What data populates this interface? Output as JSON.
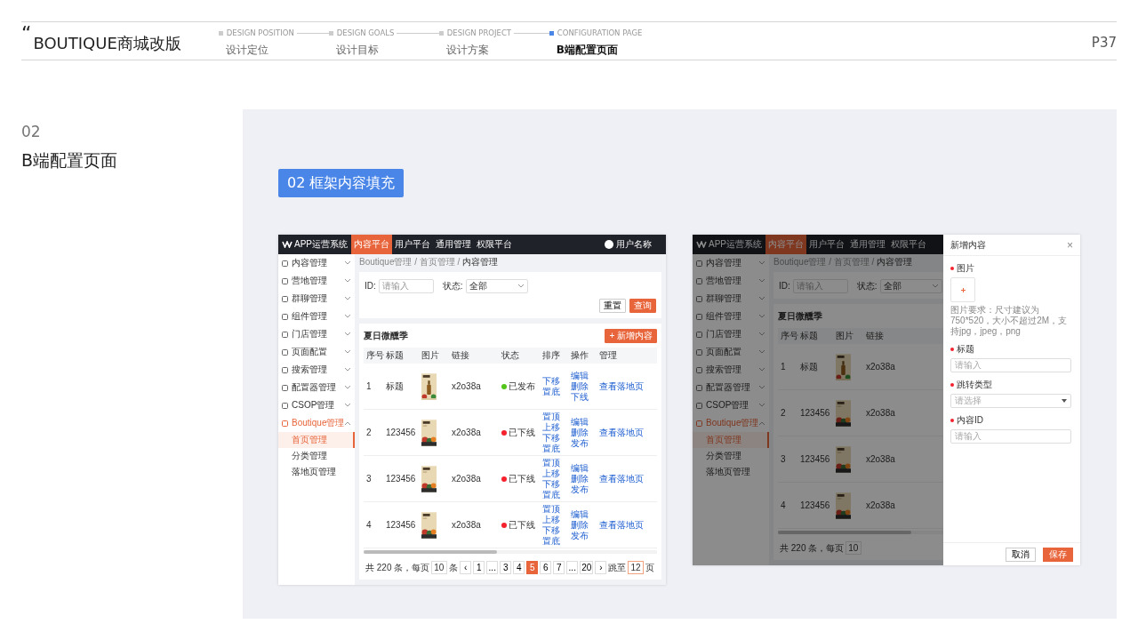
{
  "header": {
    "quote": "“",
    "title": "BOUTIQUE商城改版",
    "page": "P37",
    "steps": [
      {
        "en": "DESIGN POSITION",
        "zh": "设计定位",
        "selected": false
      },
      {
        "en": "DESIGN GOALS",
        "zh": "设计目标",
        "selected": false
      },
      {
        "en": "DESIGN PROJECT",
        "zh": "设计方案",
        "selected": false
      },
      {
        "en": "CONFIGURATION PAGE",
        "zh": "B端配置页面",
        "selected": true
      }
    ]
  },
  "section": {
    "number": "02",
    "title": "B端配置页面"
  },
  "stage_label": "02 框架内容填充",
  "mockups": [
    {
      "app_name": "APP运营系统",
      "user": "用户名称",
      "top_tabs": [
        {
          "label": "内容平台",
          "selected": true
        },
        {
          "label": "用户平台",
          "selected": false
        },
        {
          "label": "通用管理",
          "selected": false
        },
        {
          "label": "权限平台",
          "selected": false
        }
      ],
      "menu": [
        {
          "label": "内容管理",
          "expanded": false
        },
        {
          "label": "营地管理",
          "expanded": false
        },
        {
          "label": "群聊管理",
          "expanded": false
        },
        {
          "label": "组件管理",
          "expanded": false
        },
        {
          "label": "门店管理",
          "expanded": false
        },
        {
          "label": "页面配置",
          "expanded": false
        },
        {
          "label": "搜索管理",
          "expanded": false
        },
        {
          "label": "配置器管理",
          "expanded": false
        },
        {
          "label": "CSOP管理",
          "expanded": false
        },
        {
          "label": "Boutique管理",
          "expanded": true,
          "children": [
            {
              "label": "首页管理",
              "selected": true
            },
            {
              "label": "分类管理",
              "selected": false
            },
            {
              "label": "落地页管理",
              "selected": false
            }
          ]
        }
      ],
      "breadcrumb": "Boutique管理 / 首页管理 / **内容管理**",
      "filters": [
        {
          "kind": "input",
          "label": "ID:",
          "placeholder": "请输入"
        },
        {
          "kind": "select",
          "label": "状态:",
          "value": "全部"
        }
      ],
      "filter_buttons": [
        {
          "kind": "default",
          "label": "重置"
        },
        {
          "kind": "primary",
          "label": "查询"
        }
      ],
      "table_title": "夏日微醺季",
      "add_button": "+ 新增内容",
      "columns": [
        "序号",
        "标题",
        "图片",
        "链接",
        "状态",
        "排序",
        "操作",
        "管理"
      ],
      "rows": [
        {
          "index": "1",
          "title": "标题",
          "image": {
            "kind": "picture"
          },
          "link": "x2o38a",
          "status": {
            "label": "已发布",
            "color": "#52c41a"
          },
          "sort": [
            "下移",
            "置底"
          ],
          "actions": [
            "编辑",
            "删除",
            "下线"
          ],
          "manage": "查看落地页"
        },
        {
          "index": "2",
          "title": "123456",
          "image": {
            "kind": "picture"
          },
          "link": "x2o38a",
          "status": {
            "label": "已下线",
            "color": "#f5222d"
          },
          "sort": [
            "置顶",
            "上移",
            "下移",
            "置底"
          ],
          "actions": [
            "编辑",
            "删除",
            "发布"
          ],
          "manage": "查看落地页"
        },
        {
          "index": "3",
          "title": "123456",
          "image": {
            "kind": "picture"
          },
          "link": "x2o38a",
          "status": {
            "label": "已下线",
            "color": "#f5222d"
          },
          "sort": [
            "置顶",
            "上移",
            "下移",
            "置底"
          ],
          "actions": [
            "编辑",
            "删除",
            "发布"
          ],
          "manage": "查看落地页"
        },
        {
          "index": "4",
          "title": "123456",
          "image": {
            "kind": "picture"
          },
          "link": "x2o38a",
          "status": {
            "label": "已下线",
            "color": "#f5222d"
          },
          "sort": [
            "置顶",
            "上移",
            "下移",
            "置底"
          ],
          "actions": [
            "编辑",
            "删除",
            "发布"
          ],
          "manage": "查看落地页"
        }
      ],
      "pagination": {
        "total": "共 220 条，每页",
        "page_size": "10",
        "unit": "条",
        "pages": [
          {
            "label": "‹",
            "selected": false
          },
          {
            "label": "1",
            "selected": false
          },
          {
            "label": "...",
            "selected": false
          },
          {
            "label": "3",
            "selected": false
          },
          {
            "label": "4",
            "selected": false
          },
          {
            "label": "5",
            "selected": true
          },
          {
            "label": "6",
            "selected": false
          },
          {
            "label": "7",
            "selected": false
          },
          {
            "label": "...",
            "selected": false
          },
          {
            "label": "20",
            "selected": false
          },
          {
            "label": "›",
            "selected": false
          }
        ],
        "jump_label": "跳至",
        "jump_value": "12",
        "jump_unit": "页"
      }
    },
    {
      "app_name": "APP运营系统",
      "top_tabs": [
        {
          "label": "内容平台",
          "selected": true
        },
        {
          "label": "用户平台",
          "selected": false
        },
        {
          "label": "通用管理",
          "selected": false
        },
        {
          "label": "权限平台",
          "selected": false
        }
      ],
      "menu": [
        {
          "label": "内容管理",
          "expanded": false
        },
        {
          "label": "营地管理",
          "expanded": false
        },
        {
          "label": "群聊管理",
          "expanded": false
        },
        {
          "label": "组件管理",
          "expanded": false
        },
        {
          "label": "门店管理",
          "expanded": false
        },
        {
          "label": "页面配置",
          "expanded": false
        },
        {
          "label": "搜索管理",
          "expanded": false
        },
        {
          "label": "配置器管理",
          "expanded": false
        },
        {
          "label": "CSOP管理",
          "expanded": false
        },
        {
          "label": "Boutique管理",
          "expanded": true,
          "children": [
            {
              "label": "首页管理",
              "selected": true
            },
            {
              "label": "分类管理",
              "selected": false
            },
            {
              "label": "落地页管理",
              "selected": false
            }
          ]
        }
      ],
      "breadcrumb": "Boutique管理 / 首页管理 / **内容管理**",
      "filters": [
        {
          "kind": "input",
          "label": "ID:",
          "placeholder": "请输入"
        },
        {
          "kind": "select",
          "label": "状态:",
          "value": "全部"
        }
      ],
      "table_title": "夏日微醺季",
      "columns": [
        "序号",
        "标题",
        "图片",
        "链接"
      ],
      "rows": [
        {
          "index": "1",
          "title": "标题",
          "image": {
            "kind": "picture"
          },
          "link": "x2o38a"
        },
        {
          "index": "2",
          "title": "123456",
          "image": {
            "kind": "picture"
          },
          "link": "x2o38a"
        },
        {
          "index": "3",
          "title": "123456",
          "image": {
            "kind": "picture"
          },
          "link": "x2o38a"
        },
        {
          "index": "4",
          "title": "123456",
          "image": {
            "kind": "picture"
          },
          "link": "x2o38a"
        }
      ],
      "pagination": {
        "total": "共 220 条，每页",
        "page_size": "10"
      },
      "drawer": {
        "title": "新增内容",
        "close": "×",
        "fields": [
          {
            "kind": "upload",
            "label": "图片",
            "required": true,
            "hint": "图片要求：尺寸建议为750*520，大小不超过2M，支持jpg，jpeg，png"
          },
          {
            "kind": "input",
            "label": "标题",
            "required": true,
            "placeholder": "请输入"
          },
          {
            "kind": "select",
            "label": "跳转类型",
            "required": true,
            "placeholder": "请选择"
          },
          {
            "kind": "input",
            "label": "内容ID",
            "required": true,
            "placeholder": "请输入"
          }
        ],
        "buttons": [
          {
            "kind": "default",
            "label": "取消"
          },
          {
            "kind": "primary",
            "label": "保存"
          }
        ]
      }
    }
  ]
}
